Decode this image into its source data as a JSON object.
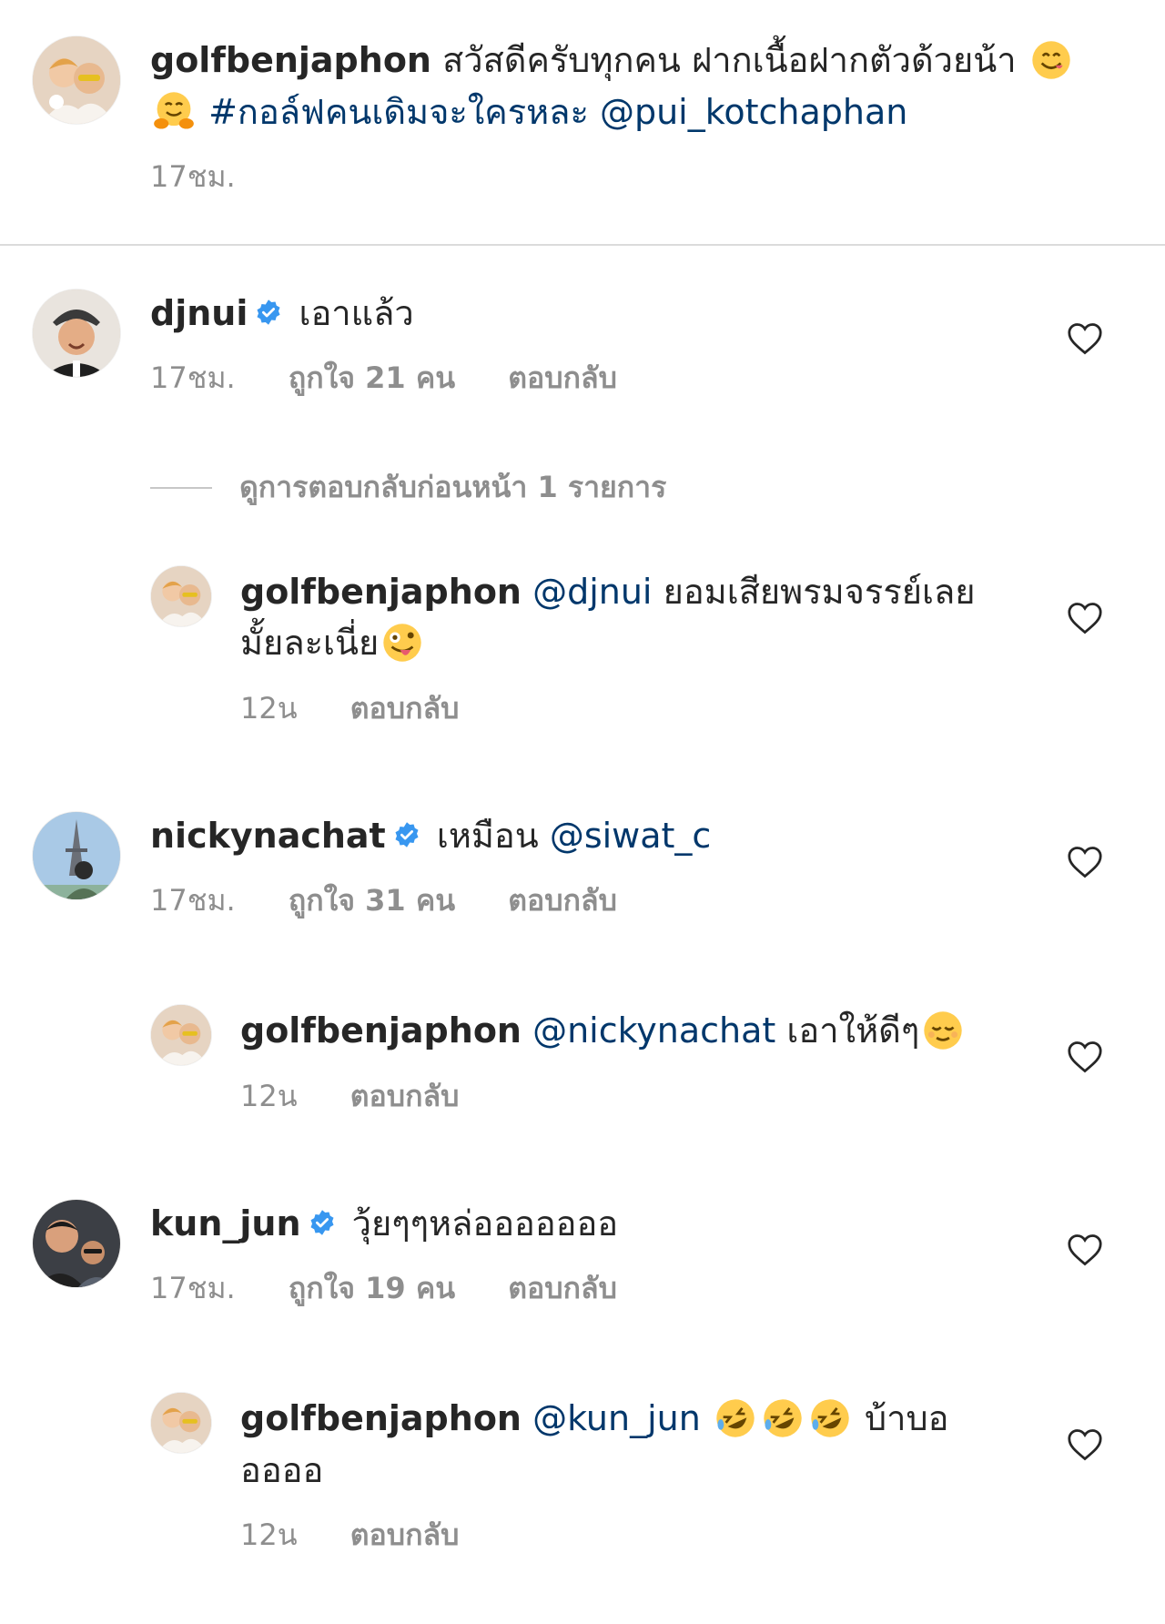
{
  "caption": {
    "username": "golfbenjaphon",
    "text": "สวัสดีครับทุกคน ฝากเนื้อฝากตัวด้วยน้า",
    "hashtag": "#กอล์ฟคนเดิมจะใครหละ",
    "mention": "@pui_kotchaphan",
    "time": "17ชม."
  },
  "comments": [
    {
      "username": "djnui",
      "verified": true,
      "text": "เอาแล้ว",
      "time": "17ชม.",
      "likes": "ถูกใจ 21 คน",
      "reply_label": "ตอบกลับ",
      "view_previous": "ดูการตอบกลับก่อนหน้า 1 รายการ",
      "reply": {
        "username": "golfbenjaphon",
        "mention": "@djnui",
        "text_line1": "ยอมเสียพรมจรรย์เลย",
        "text_line2": "มั้ยละเนี่ย",
        "time": "12น",
        "reply_label": "ตอบกลับ"
      }
    },
    {
      "username": "nickynachat",
      "verified": true,
      "text": "เหมือน",
      "mention": "@siwat_c",
      "time": "17ชม.",
      "likes": "ถูกใจ 31 คน",
      "reply_label": "ตอบกลับ",
      "reply": {
        "username": "golfbenjaphon",
        "mention": "@nickynachat",
        "text": "เอาให้ดีๆ",
        "time": "12น",
        "reply_label": "ตอบกลับ"
      }
    },
    {
      "username": "kun_jun",
      "verified": true,
      "text": "วุ้ยๆๆหล่อออออออ",
      "time": "17ชม.",
      "likes": "ถูกใจ 19 คน",
      "reply_label": "ตอบกลับ",
      "reply": {
        "username": "golfbenjaphon",
        "mention": "@kun_jun",
        "text_line1": "บ้าบอ",
        "text_line2": "ออออ",
        "time": "12น",
        "reply_label": "ตอบกลับ"
      }
    }
  ],
  "icons": {
    "heart": "heart-outline-icon",
    "verified": "verified-badge-icon",
    "verified_color": "#3897f0"
  }
}
